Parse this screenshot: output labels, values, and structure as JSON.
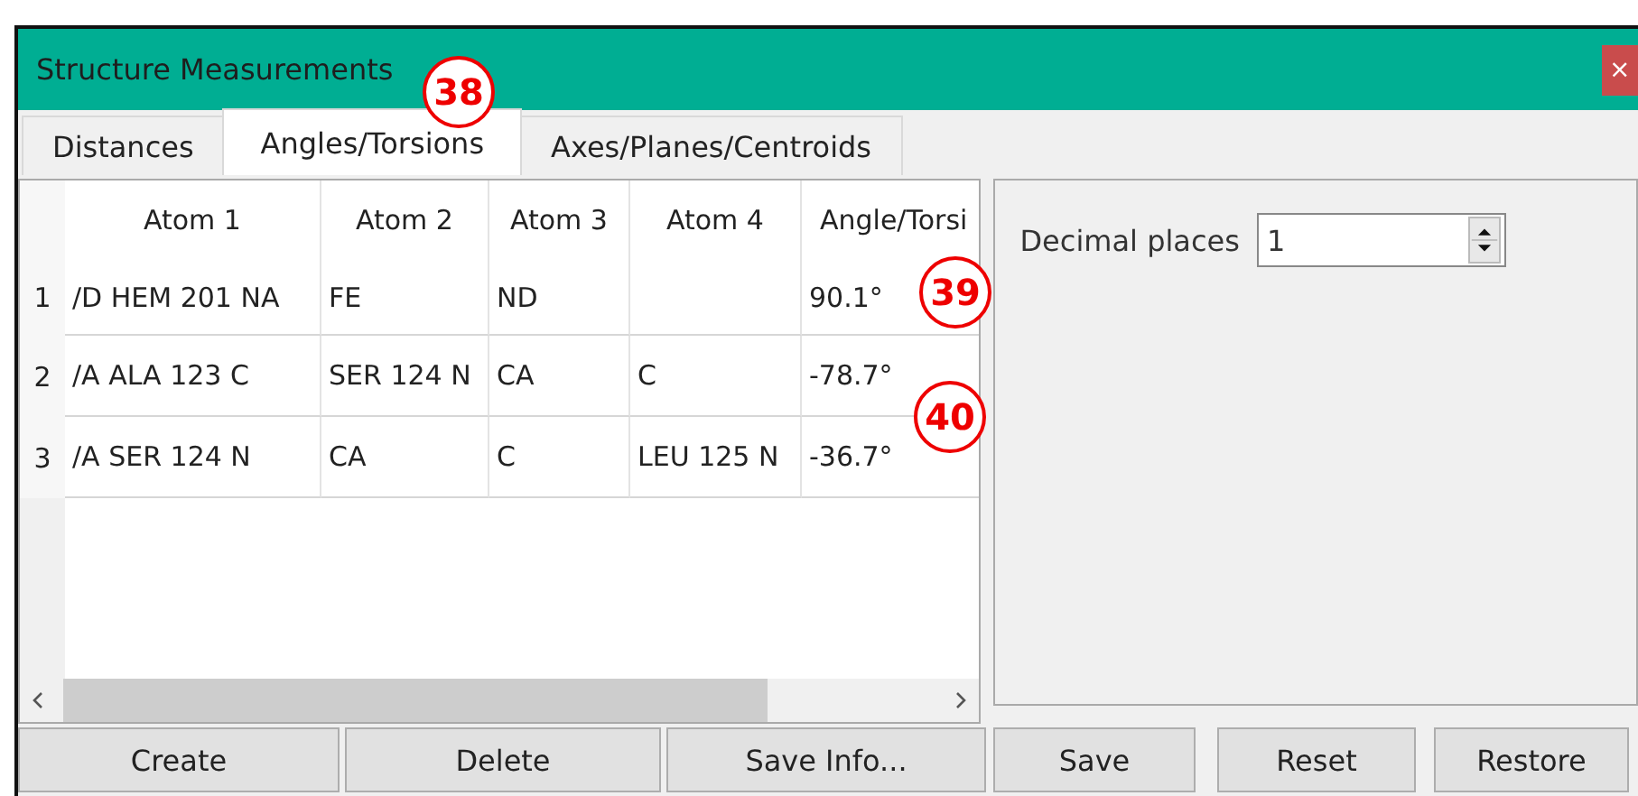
{
  "window": {
    "title": "Structure Measurements",
    "close": "×"
  },
  "tabs": [
    {
      "label": "Distances",
      "selected": false
    },
    {
      "label": "Angles/Torsions",
      "selected": true
    },
    {
      "label": "Axes/Planes/Centroids",
      "selected": false
    }
  ],
  "table": {
    "columns": [
      "Atom 1",
      "Atom 2",
      "Atom 3",
      "Atom 4",
      "Angle/Torsi"
    ],
    "rows": [
      {
        "number": "1",
        "cells": [
          "/D HEM 201 NA",
          "FE",
          "ND",
          "",
          "90.1°"
        ]
      },
      {
        "number": "2",
        "cells": [
          "/A ALA 123 C",
          "SER 124 N",
          "CA",
          "C",
          "-78.7°"
        ]
      },
      {
        "number": "3",
        "cells": [
          "/A SER 124 N",
          "CA",
          "C",
          "LEU 125 N",
          "-36.7°"
        ]
      }
    ]
  },
  "settings": {
    "decimal_places_label": "Decimal places",
    "decimal_places": "1"
  },
  "buttons": [
    "Create",
    "Delete",
    "Save Info...",
    "Save",
    "Reset",
    "Restore"
  ],
  "callouts": [
    {
      "label": "38",
      "kind": "title"
    },
    {
      "label": "39",
      "kind": "row1"
    },
    {
      "label": "40",
      "kind": "row2"
    }
  ]
}
